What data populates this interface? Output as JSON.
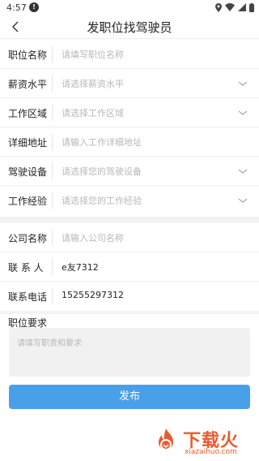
{
  "status_bar": {
    "time": "4:57",
    "badge": "!",
    "icons": [
      "location-icon",
      "wifi-icon",
      "signal-icon",
      "battery-icon"
    ]
  },
  "nav": {
    "title": "发职位找驾驶员",
    "back_icon": "chevron-left-icon"
  },
  "job_section": [
    {
      "label": "职位名称",
      "value": "请填写职位名称",
      "filled": false,
      "has_dropdown": false
    },
    {
      "label": "薪资水平",
      "value": "请选择薪资水平",
      "filled": false,
      "has_dropdown": true
    },
    {
      "label": "工作区域",
      "value": "请选择工作区域",
      "filled": false,
      "has_dropdown": true
    },
    {
      "label": "详细地址",
      "value": "请输入工作详细地址",
      "filled": false,
      "has_dropdown": false
    },
    {
      "label": "驾驶设备",
      "value": "请选择您的驾驶设备",
      "filled": false,
      "has_dropdown": true
    },
    {
      "label": "工作经验",
      "value": "请选择您的工作经验",
      "filled": false,
      "has_dropdown": true
    }
  ],
  "company_section": [
    {
      "label": "公司名称",
      "value": "请输入公司名称",
      "filled": false
    },
    {
      "label": "联 系 人",
      "value": "e友7312",
      "filled": true
    },
    {
      "label": "联系电话",
      "value": "15255297312",
      "filled": true
    }
  ],
  "requirements": {
    "label": "职位要求",
    "placeholder": "请填写职责和要求"
  },
  "submit_label": "发布",
  "watermark": {
    "text": "下载火",
    "subtext": "xiazaihuo.com"
  },
  "colors": {
    "accent": "#4a9fe9",
    "placeholder": "#b8b8b8",
    "section_gap": "#f3f3f3",
    "watermark": "#ea5a2e"
  }
}
